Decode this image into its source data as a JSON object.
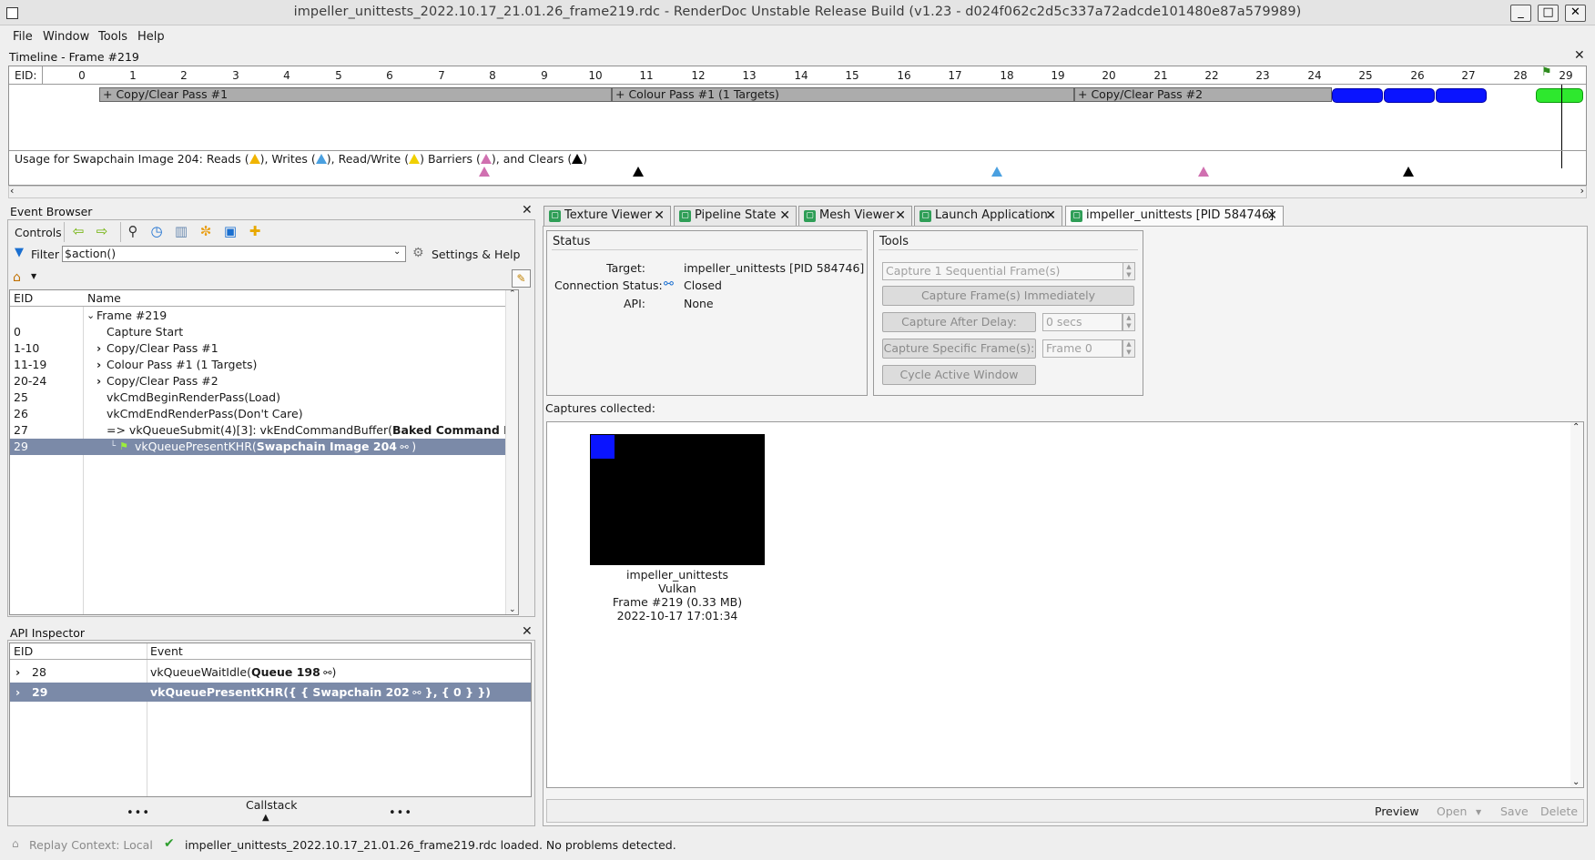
{
  "window": {
    "title": "impeller_unittests_2022.10.17_21.01.26_frame219.rdc - RenderDoc Unstable Release Build (v1.23 - d024f062c2d5c337a72adcde101480e87a579989)",
    "minimize": "_",
    "maximize": "□",
    "close": "✕"
  },
  "menu": [
    "File",
    "Window",
    "Tools",
    "Help"
  ],
  "timeline": {
    "title": "Timeline - Frame #219",
    "eid_label": "EID:",
    "ticks": [
      "0",
      "1",
      "2",
      "3",
      "4",
      "5",
      "6",
      "7",
      "8",
      "9",
      "10",
      "11",
      "12",
      "13",
      "14",
      "15",
      "16",
      "17",
      "18",
      "19",
      "20",
      "21",
      "22",
      "23",
      "24",
      "25",
      "26",
      "27",
      "28",
      "29"
    ],
    "passes": [
      "+ Copy/Clear Pass #1",
      "+ Colour Pass #1 (1 Targets)",
      "+ Copy/Clear Pass #2"
    ],
    "usage": {
      "prefix": "Usage for Swapchain Image 204:  Reads (",
      "reads_close": "), Writes (",
      "writes_close": "), Read/Write (",
      "rw_close": ")  Barriers (",
      "barriers_close": "), and Clears (",
      "end": ")"
    },
    "colors": {
      "reads": "#f0b400",
      "writes": "#4aa0e0",
      "readwrite": "#f0d000",
      "barriers": "#d070b0",
      "clears": "#000000"
    }
  },
  "event_browser": {
    "title": "Event Browser",
    "controls_label": "Controls",
    "filter_label": "Filter",
    "filter_value": "$action()",
    "settings_label": "Settings & Help",
    "col_eid": "EID",
    "col_name": "Name",
    "rows": [
      {
        "eid": "",
        "name": "Frame #219"
      },
      {
        "eid": "0",
        "name": "Capture Start"
      },
      {
        "eid": "1-10",
        "name": "Copy/Clear Pass #1"
      },
      {
        "eid": "11-19",
        "name": "Colour Pass #1 (1 Targets)"
      },
      {
        "eid": "20-24",
        "name": "Copy/Clear Pass #2"
      },
      {
        "eid": "25",
        "name": "vkCmdBeginRenderPass(Load)"
      },
      {
        "eid": "26",
        "name": "vkCmdEndRenderPass(Don't Care)"
      },
      {
        "eid": "27",
        "name": "=> vkQueueSubmit(4)[3]: vkEndCommandBuffer(",
        "bold": "Baked Command Buffe"
      },
      {
        "eid": "29",
        "name": "vkQueuePresentKHR(",
        "bold": "Swapchain Image 204",
        "tail": ")"
      }
    ]
  },
  "api_inspector": {
    "title": "API Inspector",
    "col_eid": "EID",
    "col_event": "Event",
    "rows": [
      {
        "eid": "28",
        "event": "vkQueueWaitIdle(",
        "bold": "Queue 198",
        "tail": ")"
      },
      {
        "eid": "29",
        "event": "vkQueuePresentKHR({ { Swapchain 202",
        "tail": " }, { 0 } })"
      }
    ],
    "callstack": "Callstack",
    "dots": "•••"
  },
  "tabs": [
    "Texture Viewer",
    "Pipeline State",
    "Mesh Viewer",
    "Launch Application",
    "impeller_unittests [PID 584746]"
  ],
  "status": {
    "title": "Status",
    "target_label": "Target:",
    "target_value": "impeller_unittests [PID 584746]",
    "conn_label": "Connection Status:",
    "conn_value": "Closed",
    "api_label": "API:",
    "api_value": "None"
  },
  "tools": {
    "title": "Tools",
    "seq_frames": "Capture 1 Sequential Frame(s)",
    "capture_now": "Capture Frame(s) Immediately",
    "after_delay": "Capture After Delay:",
    "delay_value": "0 secs",
    "specific": "Capture Specific Frame(s):",
    "frame_value": "Frame 0",
    "cycle": "Cycle Active Window"
  },
  "captures": {
    "label": "Captures collected:",
    "items": [
      {
        "name": "impeller_unittests",
        "api": "Vulkan",
        "frame": "Frame #219 (0.33 MB)",
        "date": "2022-10-17 17:01:34"
      }
    ]
  },
  "bottom_buttons": {
    "preview": "Preview",
    "open": "Open",
    "save": "Save",
    "delete": "Delete"
  },
  "statusbar": {
    "replay": "Replay Context: Local",
    "message": "impeller_unittests_2022.10.17_21.01.26_frame219.rdc loaded. No problems detected."
  }
}
